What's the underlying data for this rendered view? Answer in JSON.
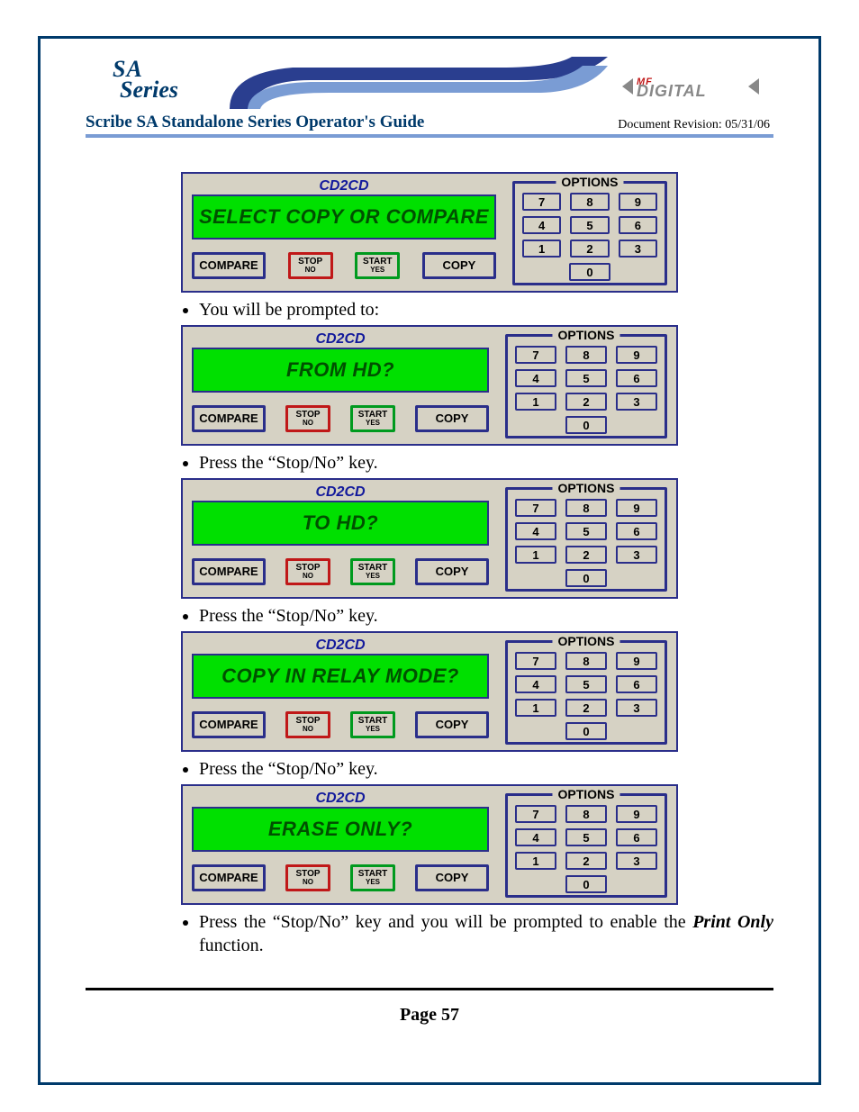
{
  "header": {
    "logo_line1": "SA",
    "logo_line2": "Series",
    "brand": "DIGITAL",
    "brand_prefix": "MF",
    "title": "Scribe SA Standalone Series Operator's Guide",
    "revision": "Document Revision: 05/31/06"
  },
  "device": {
    "brand": "CD2CD",
    "buttons": {
      "compare": "COMPARE",
      "stop_top": "STOP",
      "stop_sub": "NO",
      "start_top": "START",
      "start_sub": "YES",
      "copy": "COPY"
    },
    "options_label": "OPTIONS",
    "keypad": [
      "7",
      "8",
      "9",
      "4",
      "5",
      "6",
      "1",
      "2",
      "3"
    ],
    "keypad_zero": "0"
  },
  "screens": [
    {
      "text": "SELECT COPY OR COMPARE"
    },
    {
      "text": "FROM HD?"
    },
    {
      "text": "TO HD?"
    },
    {
      "text": "COPY IN RELAY MODE?"
    },
    {
      "text": "ERASE ONLY?"
    }
  ],
  "steps": {
    "s1": "You will be prompted to:",
    "s2": "Press the “Stop/No” key.",
    "s3": "Press the “Stop/No” key.",
    "s4": "Press the “Stop/No” key.",
    "s5a": "Press the “Stop/No” key and you will be prompted to enable the ",
    "s5b": "Print Only",
    "s5c": " function."
  },
  "footer": {
    "page": "Page 57"
  }
}
